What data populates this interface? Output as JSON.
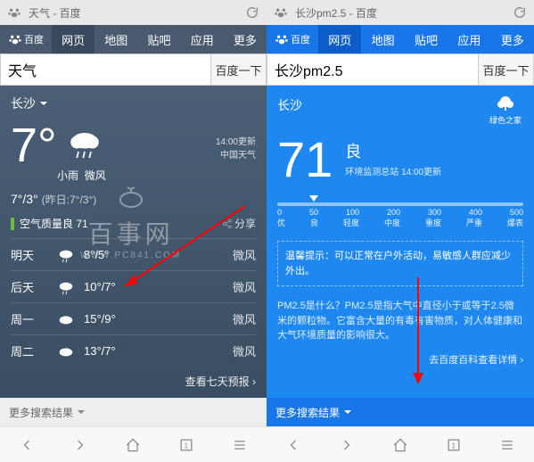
{
  "left": {
    "addr": "天气 - 百度",
    "logo": "百度",
    "tabs": [
      "网页",
      "地图",
      "贴吧",
      "应用",
      "更多"
    ],
    "query": "天气",
    "searchBtn": "百度一下",
    "city": "长沙",
    "updateTime": "14:00更新",
    "updateSrc": "中国天气",
    "temp": "7°",
    "cond": "小雨",
    "wind": "微风",
    "hi": "7°",
    "lo": "3°",
    "yesterday": "(昨日:7°/3°)",
    "aqi": "空气质量良 71",
    "share": "分享",
    "forecast": [
      {
        "day": "明天",
        "icon": "rain",
        "temp": "8°/5°",
        "wind": "微风"
      },
      {
        "day": "后天",
        "icon": "rain",
        "temp": "10°/7°",
        "wind": "微风"
      },
      {
        "day": "周一",
        "icon": "cloud",
        "temp": "15°/9°",
        "wind": "微风"
      },
      {
        "day": "周二",
        "icon": "cloud",
        "temp": "13°/7°",
        "wind": "微风"
      }
    ],
    "seven": "查看七天预报 ›",
    "more": "更多搜索结果",
    "watermark1": "百事网",
    "watermark2": "WWW.PC841.COM"
  },
  "right": {
    "addr": "长沙pm2.5 - 百度",
    "logo": "百度",
    "tabs": [
      "网页",
      "地图",
      "贴吧",
      "应用",
      "更多"
    ],
    "query": "长沙pm2.5",
    "searchBtn": "百度一下",
    "city": "长沙",
    "source": "绿色之家",
    "pm": "71",
    "grade": "良",
    "time": "环境监测总站 14:00更新",
    "scaleVals": [
      "0",
      "50",
      "100",
      "200",
      "300",
      "400",
      "500"
    ],
    "scaleTxts": [
      "优",
      "良",
      "轻度",
      "中度",
      "重度",
      "严重",
      "爆表"
    ],
    "tipLabel": "温馨提示：",
    "tip": "可以正常在户外活动，易敏感人群应减少外出。",
    "explain": "PM2.5是什么？PM2.5是指大气中直径小于或等于2.5微米的颗粒物。它富含大量的有毒有害物质，对人体健康和大气环境质量的影响很大。",
    "baike": "去百度百科查看详情 ›",
    "more": "更多搜索结果"
  }
}
